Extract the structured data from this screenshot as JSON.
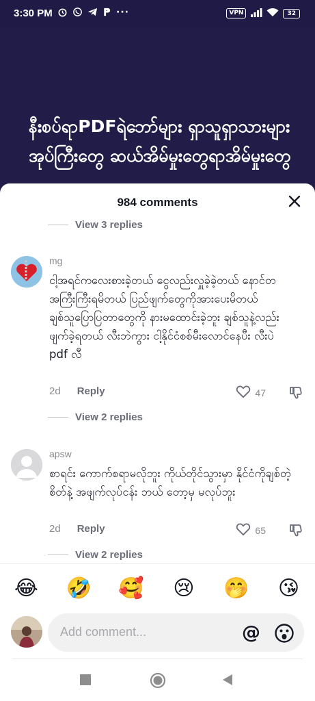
{
  "status_bar": {
    "time": "3:30 PM",
    "vpn": "VPN",
    "battery": "32",
    "more": "···"
  },
  "video": {
    "overlay_text": "နီးစပ်ရာPDFရဲဘော်များ ရှာသူရှာသားများအုပ်ကြီးတွေ ဆယ်အိမ်မှုးတွေရာအိမ်မှုးတွေ"
  },
  "sheet": {
    "title": "984 comments",
    "view_replies_top": "View 3 replies",
    "comments": [
      {
        "username": "mg",
        "text": "ငါ့အရင်ကလေးစားခဲ့တယ် ငွေလည်းလှူခဲ့ခဲ့တယ် နောင်တအကြီးကြီးရမိတယ် ပြည်ဖျက်တွေကိုအားပေးမိတယ် ချစ်သူပြောပြတာတွေကို နားမထောင်းခဲ့ဘူး ချစ်သူနဲ့လည်းဖျက်ခဲ့ရတယ် လီးဘဲကွား ငါ့နိုင်ငံစစ်မီးလောင်နေပီး လီးပဲ pdf လီ",
        "age": "2d",
        "reply_label": "Reply",
        "likes": "47",
        "view_replies": "View 2 replies"
      },
      {
        "username": "apsw",
        "text": "စာရင်း ကောက်စရာမလိုဘူး ကိုယ်တိုင်သွားမှာ နိုင်ငံကိုချစ်တဲ့စိတ်နဲ့ အဖျက်လုပ်ငန်း ဘယ် တော့မှ မလုပ်ဘူး",
        "age": "2d",
        "reply_label": "Reply",
        "likes": "65",
        "view_replies": "View 2 replies"
      }
    ],
    "emojis": [
      "😂",
      "🤣",
      "🥰",
      "😢",
      "🤭",
      "😘"
    ],
    "input_placeholder": "Add comment...",
    "at_symbol": "@"
  }
}
